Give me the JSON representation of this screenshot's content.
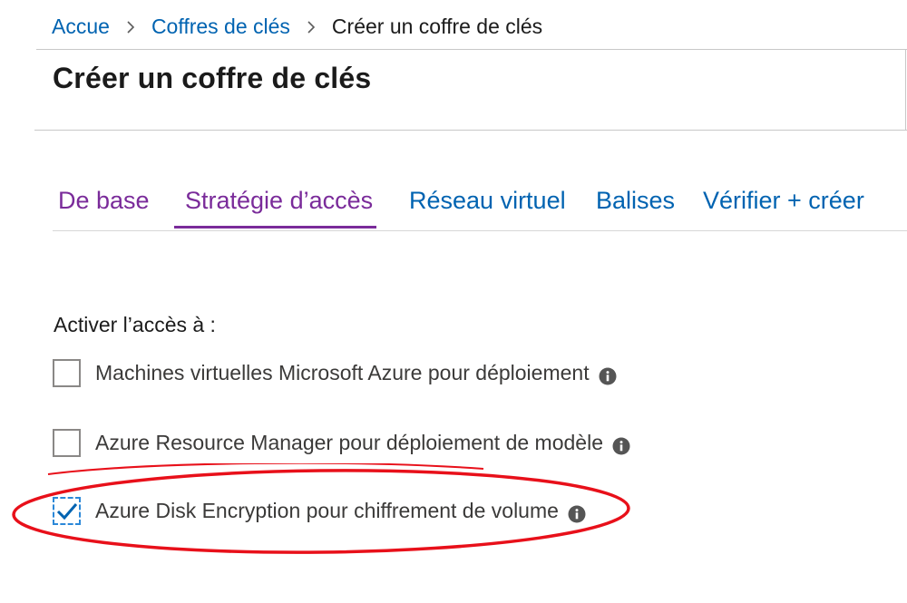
{
  "breadcrumb": {
    "home": "Accue",
    "parent": "Coffres de clés",
    "current": "Créer un coffre de clés"
  },
  "page": {
    "title": "Créer un coffre de clés"
  },
  "tabs": [
    {
      "label": "De base"
    },
    {
      "label": "Stratégie d’accès",
      "active": true
    },
    {
      "label": "Réseau virtuel"
    },
    {
      "label": "Balises"
    },
    {
      "label": "Vérifier + créer"
    }
  ],
  "access": {
    "label": "Activer l’accès à :",
    "options": [
      {
        "label": "Machines virtuelles Microsoft Azure pour déploiement",
        "checked": false
      },
      {
        "label": "Azure Resource Manager pour déploiement de modèle",
        "checked": false
      },
      {
        "label": "Azure Disk Encryption pour chiffrement de volume",
        "checked": true
      }
    ]
  },
  "colors": {
    "link": "#0063b1",
    "active_tab": "#7a2b9a",
    "checkbox_check": "#0063b1",
    "annotation": "#e8101a"
  },
  "icons": [
    "chevron-right-icon",
    "info-icon",
    "checkmark-icon"
  ]
}
